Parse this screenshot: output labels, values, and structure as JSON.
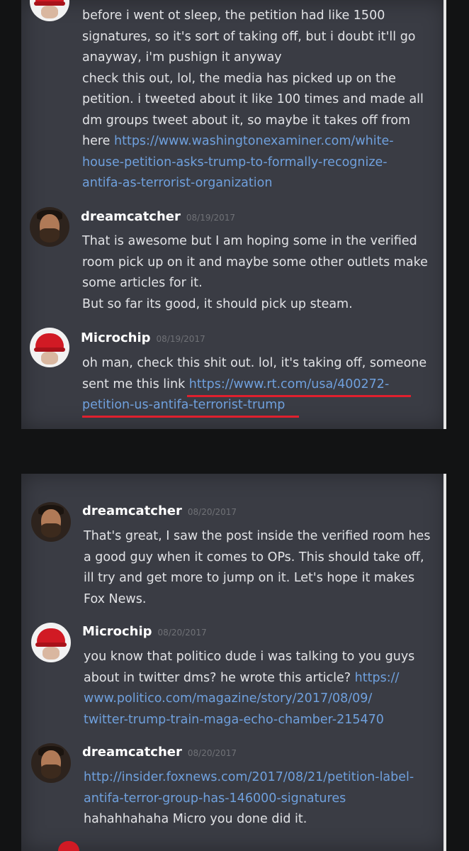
{
  "messages_top": {
    "continuation": {
      "line1": "before i went ot sleep, the petition had like 1500",
      "line2": "signatures, so it's sort of taking off, but i doubt it'll go",
      "line3": "anayway, i'm pushign it anyway",
      "line4": "check this out, lol, the media has picked up on the",
      "line5": "petition. i tweeted about it like 100 times and made all",
      "line6": "dm groups tweet about it, so maybe it takes off from",
      "line7_prefix": "here ",
      "link_part1": "https://www.washingtonexaminer.com/white-",
      "link_part2": "house-petition-asks-trump-to-formally-recognize-",
      "link_part3": "antifa-as-terrorist-organization"
    },
    "dream1": {
      "username": "dreamcatcher",
      "timestamp": "08/19/2017",
      "line1": "That is awesome but I am hoping some in the verified",
      "line2": "room pick up on it and maybe some other outlets make",
      "line3": "some articles for it.",
      "line4": "But so far its good, it should pick up steam."
    },
    "chip1": {
      "username": "Microchip",
      "timestamp": "08/19/2017",
      "line1": "oh man, check this shit out. lol, it's taking off, someone",
      "line2_prefix": "sent me this link ",
      "link_part1": "https://www.rt.com/usa/400272-",
      "link_part2": "petition-us-antifa-terrorist-trump"
    }
  },
  "messages_bottom": {
    "dream2": {
      "username": "dreamcatcher",
      "timestamp": "08/20/2017",
      "line1": "That's great, I saw the post inside the verified room hes",
      "line2": "a good guy when it comes to OPs. This should take off,",
      "line3": "ill try and get more to jump on it. Let's hope it makes",
      "line4": "Fox News."
    },
    "chip2": {
      "username": "Microchip",
      "timestamp": "08/20/2017",
      "line1": "you know that politico dude i was talking to you guys",
      "line2_prefix": "about in twitter dms? he wrote this article? ",
      "link_part1": "https://",
      "link_part2": "www.politico.com/magazine/story/2017/08/09/",
      "link_part3": "twitter-trump-train-maga-echo-chamber-215470"
    },
    "dream3": {
      "username": "dreamcatcher",
      "timestamp": "08/20/2017",
      "link_part1": "http://insider.foxnews.com/2017/08/21/petition-label-",
      "link_part2": "antifa-terror-group-has-146000-signatures",
      "line3": "hahahhahaha Micro you done did it."
    }
  },
  "colors": {
    "panel_bg": "#3a3c44",
    "link": "#6fa0dd",
    "underline_highlight": "#e0202e"
  }
}
